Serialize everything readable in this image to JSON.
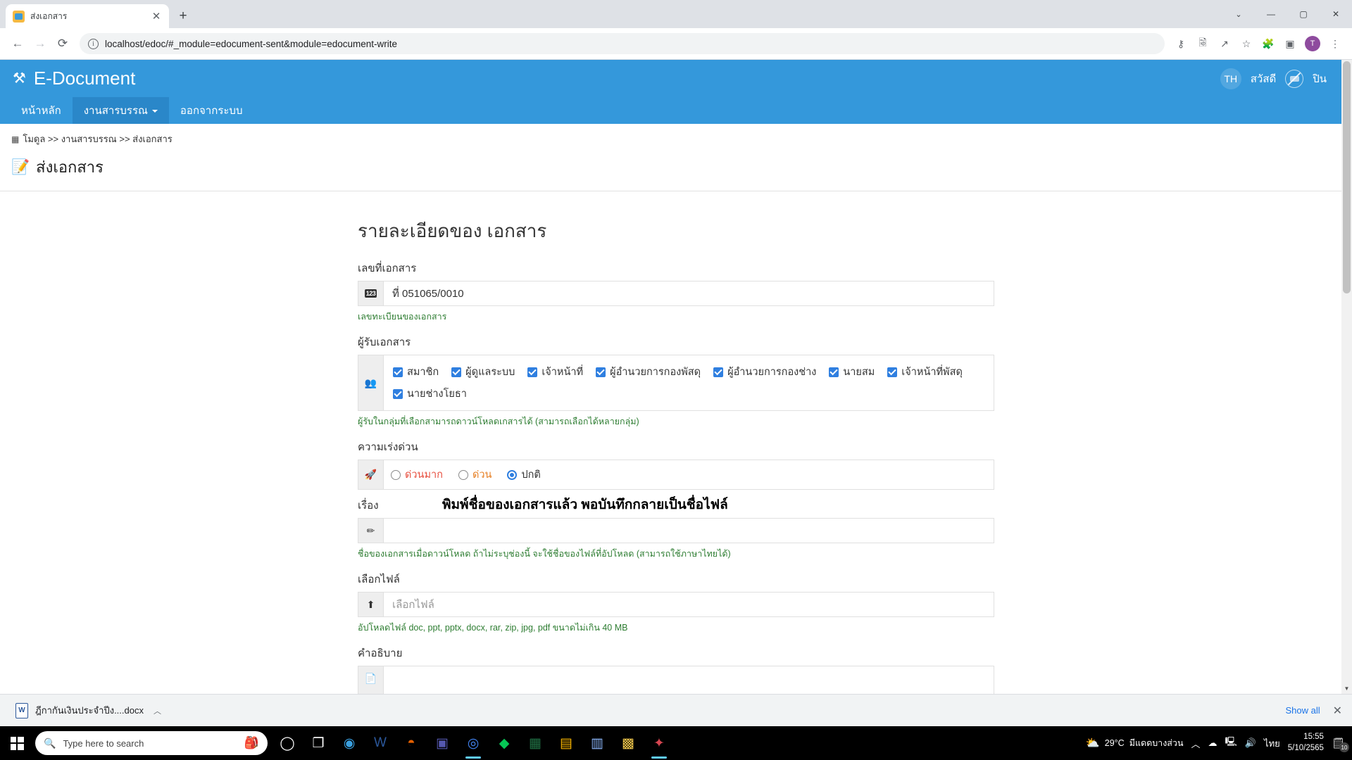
{
  "browser": {
    "tab": {
      "title": "ส่งเอกสาร",
      "favicon": "document-favicon",
      "close": "✕"
    },
    "new_tab": "+",
    "window_controls": {
      "chevron": "⌄",
      "minimize": "—",
      "maximize": "▢",
      "close": "✕"
    },
    "nav": {
      "back": "←",
      "forward": "→",
      "reload": "⟳"
    },
    "omnibox": {
      "info": "ⓘ",
      "url": "localhost/edoc/#_module=edocument-sent&module=edocument-write"
    },
    "toolbar_icons": [
      "key-icon",
      "translate-icon",
      "share-icon",
      "bookmark-star-icon",
      "extensions-icon",
      "sidepanel-icon"
    ],
    "profile_initial": "T",
    "menu": "⋮"
  },
  "app": {
    "brand_icon": "tools-icon",
    "brand_name": "E-Document",
    "lang_badge": "TH",
    "greeting": "สวัสดี",
    "username": "ปิน",
    "nav_items": [
      {
        "label": "หน้าหลัก",
        "active": false,
        "caret": false
      },
      {
        "label": "งานสารบรรณ",
        "active": true,
        "caret": true
      },
      {
        "label": "ออกจากระบบ",
        "active": false,
        "caret": false
      }
    ],
    "breadcrumb": {
      "icon": "module-grid-icon",
      "text": "โมดูล >> งานสารบรรณ >> ส่งเอกสาร"
    },
    "page_title": "ส่งเอกสาร",
    "page_title_icon": "send-document-icon"
  },
  "form": {
    "card_title": "รายละเอียดของ เอกสาร",
    "doc_number": {
      "label": "เลขที่เอกสาร",
      "addon_icon": "123-icon",
      "value": "ที่ 051065/0010",
      "help": "เลขทะเบียนของเอกสาร"
    },
    "recipients": {
      "label": "ผู้รับเอกสาร",
      "addon_icon": "users-icon",
      "options": [
        {
          "label": "สมาชิก",
          "checked": true
        },
        {
          "label": "ผู้ดูแลระบบ",
          "checked": true
        },
        {
          "label": "เจ้าหน้าที่",
          "checked": true
        },
        {
          "label": "ผู้อำนวยการกองพัสดุ",
          "checked": true
        },
        {
          "label": "ผู้อำนวยการกองช่าง",
          "checked": true
        },
        {
          "label": "นายสม",
          "checked": true
        },
        {
          "label": "เจ้าหน้าที่พัสดุ",
          "checked": true
        },
        {
          "label": "นายช่างโยธา",
          "checked": true
        }
      ],
      "help": "ผู้รับในกลุ่มที่เลือกสามารถดาวน์โหลดเกสารได้ (สามารถเลือกได้หลายกลุ่ม)"
    },
    "urgency": {
      "label": "ความเร่งด่วน",
      "addon_icon": "rocket-icon",
      "options": [
        {
          "label": "ด่วนมาก",
          "checked": false,
          "color": "#e74c3c"
        },
        {
          "label": "ด่วน",
          "checked": false,
          "color": "#e67e22"
        },
        {
          "label": "ปกติ",
          "checked": true,
          "color": "#333333"
        }
      ]
    },
    "subject": {
      "label": "เรื่อง",
      "addon_icon": "pencil-icon",
      "value": "",
      "placeholder": "",
      "help": "ชื่อของเอกสารเมื่อดาวน์โหลด ถ้าไม่ระบุช่องนี้ จะใช้ชื่อของไฟล์ที่อัปโหลด (สามารถใช้ภาษาไทยได้)",
      "annotation": "พิมพ์ชื่อของเอกสารแล้ว พอบันทึกกลายเป็นชื่อไฟล์"
    },
    "file": {
      "label": "เลือกไฟล์",
      "addon_icon": "upload-icon",
      "placeholder": "เลือกไฟล์",
      "help": "อัปโหลดไฟล์ doc, ppt, pptx, docx, rar, zip, jpg, pdf ขนาดไม่เกิน 40 MB"
    },
    "description": {
      "label": "คำอธิบาย",
      "addon_icon": "file-text-icon",
      "value": ""
    }
  },
  "download_bar": {
    "file_icon": "word-doc-icon",
    "file_name": "ฎีกากันเงินประจำปีง....docx",
    "chevron": "︿",
    "show_all": "Show all",
    "close": "✕"
  },
  "taskbar": {
    "start_icon": "windows-start-icon",
    "search_placeholder": "Type here to search",
    "search_icon": "search-icon",
    "search_deco": "🎒",
    "app_icons": [
      {
        "name": "cortana-icon",
        "glyph": "◯",
        "active": false
      },
      {
        "name": "task-view-icon",
        "glyph": "❐",
        "active": false
      },
      {
        "name": "edge-icon",
        "glyph": "◉",
        "active": false
      },
      {
        "name": "word-icon",
        "glyph": "W",
        "active": false
      },
      {
        "name": "firefox-icon",
        "glyph": "◓",
        "active": false
      },
      {
        "name": "teams-icon",
        "glyph": "▣",
        "active": false
      },
      {
        "name": "chrome-icon",
        "glyph": "◎",
        "active": true
      },
      {
        "name": "line-icon",
        "glyph": "◆",
        "active": false
      },
      {
        "name": "excel-icon",
        "glyph": "▦",
        "active": false
      },
      {
        "name": "explorer-icon",
        "glyph": "▤",
        "active": false
      },
      {
        "name": "notepad-icon",
        "glyph": "▥",
        "active": false
      },
      {
        "name": "app-icon",
        "glyph": "▩",
        "active": false
      },
      {
        "name": "paint-icon",
        "glyph": "✦",
        "active": true
      }
    ],
    "weather": {
      "icon": "partly-sunny-icon",
      "temp": "29°C",
      "desc": "มีแดดบางส่วน"
    },
    "tray": {
      "chevron": "︿",
      "onedrive": "☁",
      "network": "🖳",
      "volume": "🔊",
      "language": "ไทย"
    },
    "clock": {
      "time": "15:55",
      "date": "5/10/2565"
    },
    "notifications": {
      "icon": "notification-icon",
      "count": "10"
    }
  }
}
